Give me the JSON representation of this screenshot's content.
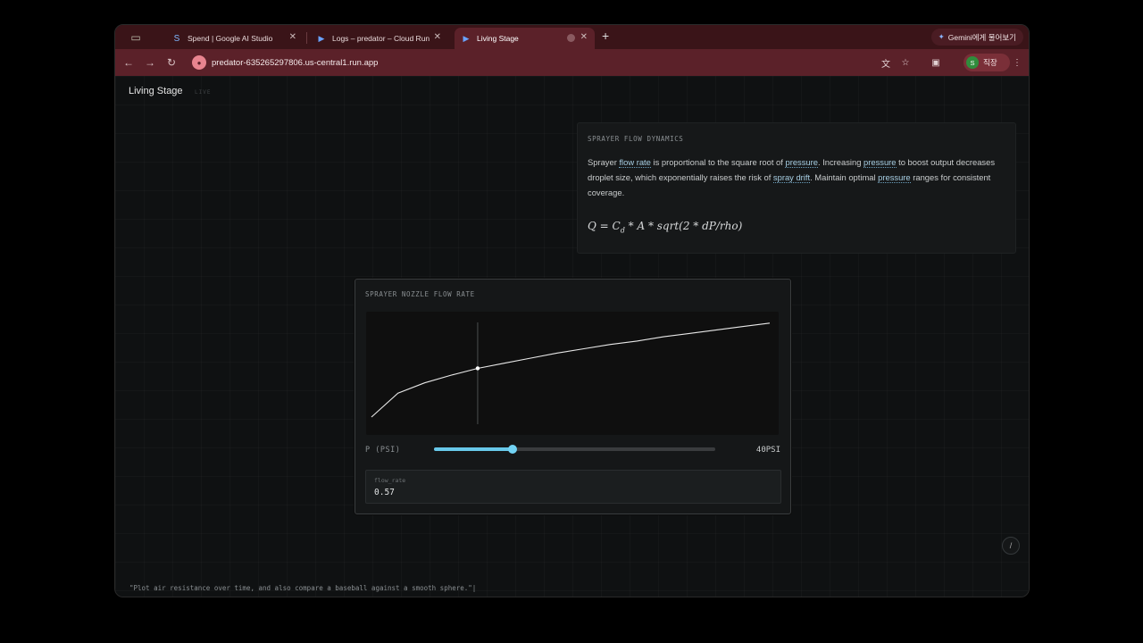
{
  "browser": {
    "tabs": [
      {
        "title": "Spend | Google AI Studio",
        "icon": "ai-studio-icon"
      },
      {
        "title": "Logs – predator – Cloud Run",
        "icon": "cloud-run-icon"
      },
      {
        "title": "Living Stage",
        "icon": "cloud-run-icon",
        "active": true
      }
    ],
    "new_tab": "+",
    "gemini_button": "Gemini에게 물어보기",
    "url": "predator-635265297806.us-central1.run.app",
    "profile": {
      "initial": "S",
      "label": "직장"
    },
    "theme_color": "#5b2129"
  },
  "app": {
    "title": "Living Stage",
    "badge": "LIVE"
  },
  "info_card": {
    "heading": "SPRAYER FLOW DYNAMICS",
    "text": [
      {
        "t": "Sprayer "
      },
      {
        "t": "flow rate",
        "kw": true
      },
      {
        "t": " is proportional to the square root of "
      },
      {
        "t": "pressure",
        "kw": true
      },
      {
        "t": ". Increasing "
      },
      {
        "t": "pressure",
        "kw": true
      },
      {
        "t": " to boost output decreases droplet size, which exponentially raises the risk of "
      },
      {
        "t": "spray drift",
        "kw": true
      },
      {
        "t": ". Maintain optimal "
      },
      {
        "t": "pressure",
        "kw": true
      },
      {
        "t": " ranges for consistent coverage."
      }
    ],
    "formula": "Q = C_d * A * sqrt(2 * dP/rho)"
  },
  "chart_card": {
    "heading": "SPRAYER NOZZLE FLOW RATE",
    "param_label": "P (PSI)",
    "param_value": "40PSI",
    "slider_fraction": 0.28,
    "readout_label": "flow_rate",
    "readout_value": "0.57",
    "accent": "#68c9ea"
  },
  "chart_data": {
    "type": "line",
    "title": "",
    "xlabel": "",
    "ylabel": "",
    "grid": false,
    "series": [
      {
        "x": [
          0,
          10,
          20,
          30,
          40,
          50,
          60,
          70,
          80,
          90,
          100,
          110,
          120,
          130,
          140,
          150
        ],
        "y": [
          0.0,
          0.28,
          0.4,
          0.49,
          0.57,
          0.63,
          0.69,
          0.75,
          0.8,
          0.85,
          0.89,
          0.94,
          0.98,
          1.02,
          1.06,
          1.1
        ]
      }
    ],
    "marker": {
      "x": 40,
      "y": 0.57
    }
  },
  "slash_button": "/",
  "prompt_text": "\"Plot air resistance over time, and also compare a baseball against a smooth sphere.\"|"
}
